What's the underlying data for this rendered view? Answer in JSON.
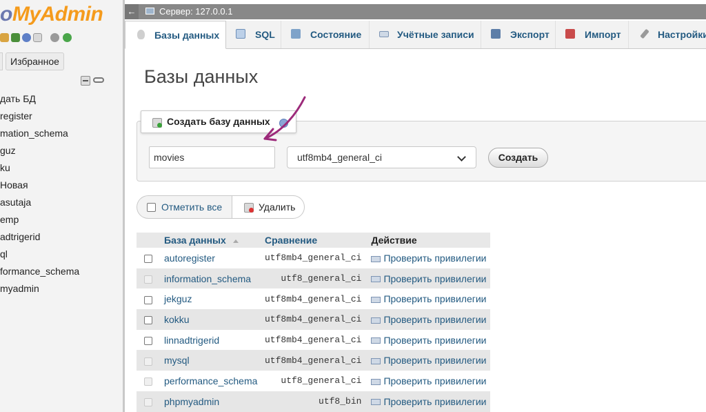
{
  "nav": {
    "logo_php": "o",
    "logo_rest": "MyAdmin",
    "favorites_label": "Избранное",
    "tree_items": [
      "дать БД",
      "register",
      "mation_schema",
      "guz",
      "ku",
      "Новая",
      "asutaja",
      "emp",
      "adtrigerid",
      "ql",
      "formance_schema",
      "myadmin"
    ]
  },
  "serverbar": {
    "back_glyph": "←",
    "label": "Сервер: 127.0.0.1"
  },
  "tabs": [
    {
      "label": "Базы данных",
      "icon": "database-icon",
      "active": true
    },
    {
      "label": "SQL",
      "icon": "sql-icon"
    },
    {
      "label": "Состояние",
      "icon": "status-icon"
    },
    {
      "label": "Учётные записи",
      "icon": "user-accounts-icon"
    },
    {
      "label": "Экспорт",
      "icon": "export-icon"
    },
    {
      "label": "Импорт",
      "icon": "import-icon"
    },
    {
      "label": "Настройки",
      "icon": "settings-icon"
    }
  ],
  "page_title": "Базы данных",
  "create_db": {
    "legend": "Создать базу данных",
    "name_value": "movies",
    "collation_value": "utf8mb4_general_ci",
    "create_label": "Создать"
  },
  "bulk": {
    "check_all_label": "Отметить все",
    "delete_label": "Удалить"
  },
  "table": {
    "headers": {
      "name": "База данных",
      "collation": "Сравнение",
      "action": "Действие"
    },
    "rows": [
      {
        "name": "autoregister",
        "collation": "utf8mb4_general_ci",
        "action": "Проверить привилегии",
        "checkable": true
      },
      {
        "name": "information_schema",
        "collation": "utf8_general_ci",
        "action": "Проверить привилегии",
        "checkable": false
      },
      {
        "name": "jekguz",
        "collation": "utf8mb4_general_ci",
        "action": "Проверить привилегии",
        "checkable": true
      },
      {
        "name": "kokku",
        "collation": "utf8mb4_general_ci",
        "action": "Проверить привилегии",
        "checkable": true
      },
      {
        "name": "linnadtrigerid",
        "collation": "utf8mb4_general_ci",
        "action": "Проверить привилегии",
        "checkable": true
      },
      {
        "name": "mysql",
        "collation": "utf8mb4_general_ci",
        "action": "Проверить привилегии",
        "checkable": false
      },
      {
        "name": "performance_schema",
        "collation": "utf8_general_ci",
        "action": "Проверить привилегии",
        "checkable": false
      },
      {
        "name": "phpmyadmin",
        "collation": "utf8_bin",
        "action": "Проверить привилегии",
        "checkable": false
      }
    ]
  },
  "colors": {
    "link": "#235a81",
    "logo_orange": "#f59b1c",
    "logo_blue": "#6c78af",
    "annotation_arrow": "#9c2a7a"
  }
}
